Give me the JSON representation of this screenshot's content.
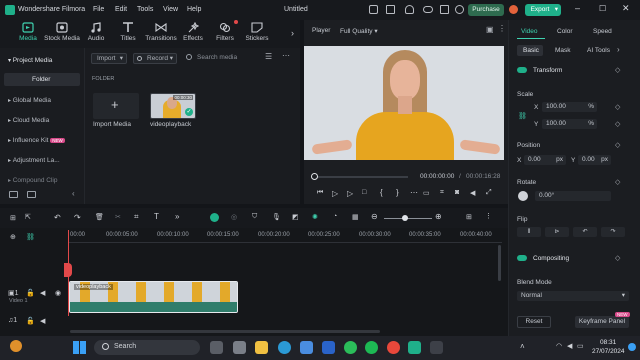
{
  "app": {
    "name": "Wondershare Filmora",
    "menu": [
      "File",
      "Edit",
      "Tools",
      "View",
      "Help"
    ],
    "doc_title": "Untitled",
    "purchase_label": "Purchase",
    "export_label": "Export"
  },
  "tabs": [
    {
      "label": "Media",
      "icon": "media-icon",
      "active": true
    },
    {
      "label": "Stock Media",
      "icon": "stock-media-icon",
      "active": false
    },
    {
      "label": "Audio",
      "icon": "audio-icon",
      "active": false
    },
    {
      "label": "Titles",
      "icon": "titles-icon",
      "active": false
    },
    {
      "label": "Transitions",
      "icon": "transitions-icon",
      "active": false
    },
    {
      "label": "Effects",
      "icon": "effects-icon",
      "active": false
    },
    {
      "label": "Filters",
      "icon": "filters-icon",
      "active": false
    },
    {
      "label": "Stickers",
      "icon": "stickers-icon",
      "active": false
    }
  ],
  "sidebar": {
    "items": [
      "Project Media",
      "Folder",
      "Global Media",
      "Cloud Media",
      "Influence Kit",
      "Adjustment La...",
      "Compound Clip"
    ],
    "new_badge": "NEW"
  },
  "media": {
    "import_label": "Import",
    "record_label": "Record",
    "search_placeholder": "Search media",
    "folder_heading": "FOLDER",
    "import_tile_label": "Import Media",
    "clip_name": "videoplayback",
    "clip_duration": "00:00:30"
  },
  "player": {
    "label": "Player",
    "quality": "Full Quality",
    "current_time": "00:00:00:00",
    "total_time": "00:00:16:28"
  },
  "inspector": {
    "tabs": [
      "Video",
      "Color",
      "Speed"
    ],
    "subtabs": [
      "Basic",
      "Mask",
      "AI Tools"
    ],
    "transform": "Transform",
    "scale": "Scale",
    "x_label": "X",
    "y_label": "Y",
    "scale_x": "100.00",
    "scale_y": "100.00",
    "percent": "%",
    "position": "Position",
    "pos_x": "0.00",
    "pos_y": "0.00",
    "px": "px",
    "rotate": "Rotate",
    "rotate_value": "0.00°",
    "flip": "Flip",
    "compositing": "Compositing",
    "blend_mode": "Blend Mode",
    "blend_value": "Normal",
    "reset_label": "Reset",
    "keyframe_label": "Keyframe Panel",
    "keyframe_badge": "NEW"
  },
  "timeline": {
    "ticks": [
      "00:00",
      "00:00:05:00",
      "00:00:10:00",
      "00:00:15:00",
      "00:00:20:00",
      "00:00:25:00",
      "00:00:30:00",
      "00:00:35:00",
      "00:00:40:00"
    ],
    "clip_label": "videoplayback",
    "video_track": "Video 1"
  },
  "taskbar": {
    "search_label": "Search",
    "time": "08:31",
    "date": "27/07/2024"
  },
  "colors": {
    "accent": "#1fb08a",
    "active_tab": "#3fd2b0",
    "clip": "#3a8f7c",
    "playhead": "#e2494a"
  }
}
